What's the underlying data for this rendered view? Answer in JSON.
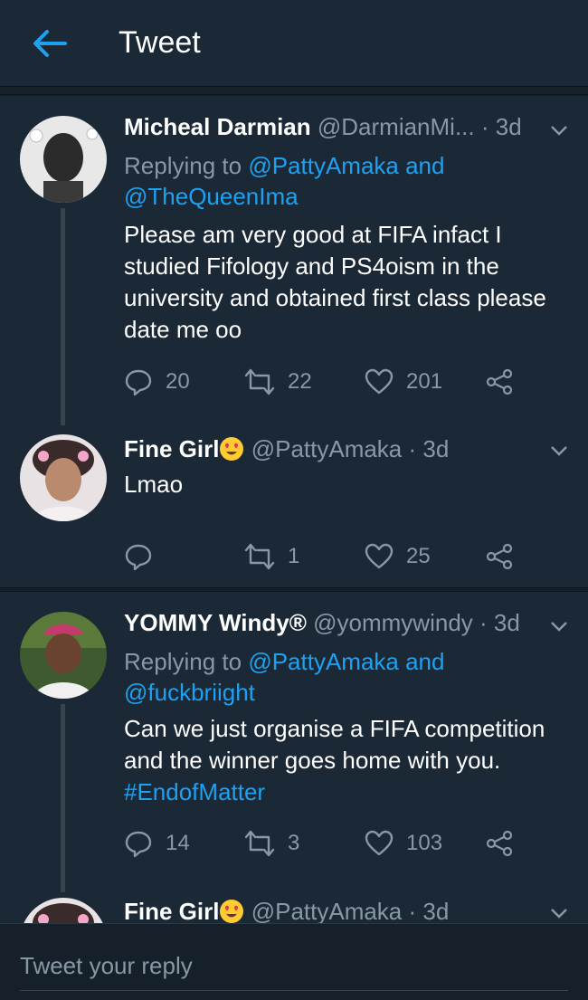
{
  "header": {
    "title": "Tweet",
    "back_icon": "arrow-left-icon"
  },
  "tweets": [
    {
      "name": "Micheal Darmian",
      "handle": "@DarmianMi...",
      "time": "· 3d",
      "reply_prefix": "Replying to",
      "reply_to_1": "@PattyAmaka and",
      "reply_to_2": "@TheQueenIma",
      "text": "Please am very good at FIFA infact I studied Fifology and PS4oism in the university and obtained first class please date me oo",
      "hashtag": "",
      "replies": "20",
      "retweets": "22",
      "likes": "201"
    },
    {
      "name": "Fine Girl",
      "handle": "@PattyAmaka",
      "time": "· 3d",
      "text": "Lmao",
      "replies": "",
      "retweets": "1",
      "likes": "25"
    },
    {
      "name": "YOMMY Windy®",
      "handle": "@yommywindy",
      "time": "· 3d",
      "reply_prefix": "Replying to",
      "reply_to_1": "@PattyAmaka and",
      "reply_to_2": "@fuckbriight",
      "text": "Can we just organise a FIFA competition and the winner goes home with you.",
      "hashtag": "#EndofMatter",
      "replies": "14",
      "retweets": "3",
      "likes": "103"
    },
    {
      "name": "Fine Girl",
      "handle": "@PattyAmaka",
      "time": "· 3d"
    }
  ],
  "reply_bar": {
    "placeholder": "Tweet your reply"
  },
  "colors": {
    "background": "#15202b",
    "card": "#1b2836",
    "accent": "#1da1f2",
    "muted": "#8899a6"
  }
}
